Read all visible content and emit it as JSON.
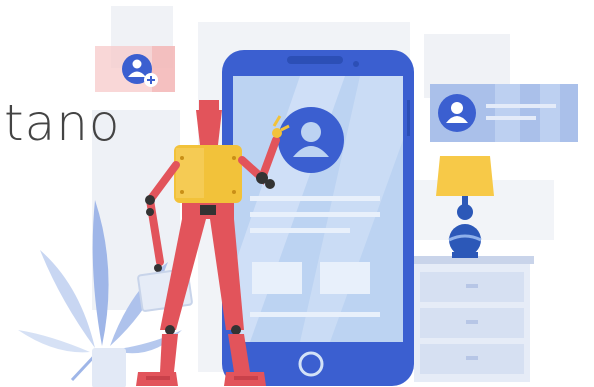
{
  "heading": {
    "text": "tano"
  },
  "colors": {
    "phone_body": "#3b5fd0",
    "phone_screen": "#bcd3f2",
    "robot_red": "#e2545b",
    "robot_yellow": "#f2c23a",
    "lamp_shade": "#f7c948",
    "lamp_base": "#2c58b8",
    "plant_blue": "#9fb6e8",
    "panel_gray": "#eef1f6"
  },
  "icons": {
    "add_user": "add-user-icon",
    "profile_avatar": "user-avatar-icon",
    "user_card": "user-card-icon",
    "lamp": "lamp-icon",
    "home_button": "home-button-icon"
  }
}
